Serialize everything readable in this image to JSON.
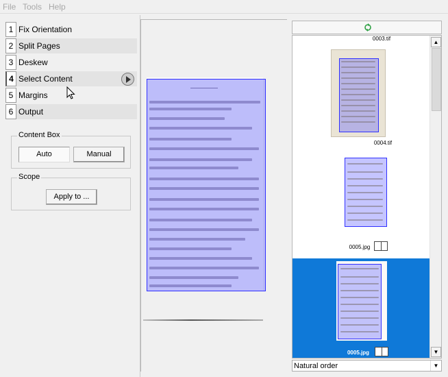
{
  "menu": {
    "file": "File",
    "tools": "Tools",
    "help": "Help"
  },
  "stages": [
    {
      "num": "1",
      "label": "Fix Orientation"
    },
    {
      "num": "2",
      "label": "Split Pages"
    },
    {
      "num": "3",
      "label": "Deskew"
    },
    {
      "num": "4",
      "label": "Select Content"
    },
    {
      "num": "5",
      "label": "Margins"
    },
    {
      "num": "6",
      "label": "Output"
    }
  ],
  "content_box": {
    "title": "Content Box",
    "auto": "Auto",
    "manual": "Manual",
    "selected": "Auto"
  },
  "scope": {
    "title": "Scope",
    "apply": "Apply to ..."
  },
  "thumbnails": {
    "top_partial": "0003.tif",
    "items": [
      {
        "name": "0004.tif"
      },
      {
        "name": "0005.jpg"
      },
      {
        "name": "0005.jpg",
        "selected": true
      }
    ]
  },
  "sort": {
    "value": "Natural order"
  },
  "colors": {
    "selection": "#0f79d8",
    "content_box": "#5a5aff"
  },
  "icons": {
    "play": "play-icon",
    "cursor": "mouse-cursor-icon",
    "refresh": "refresh-icon",
    "page": "two-page-icon"
  }
}
